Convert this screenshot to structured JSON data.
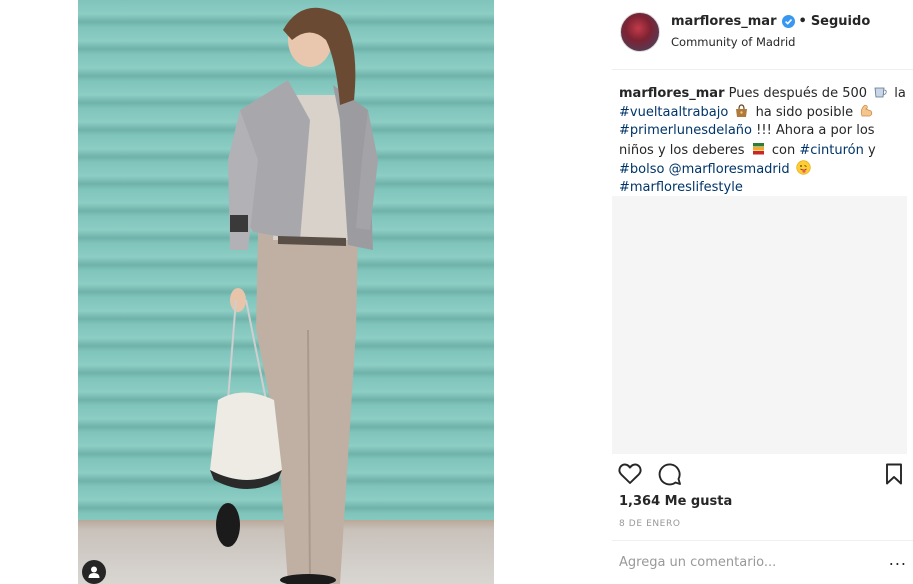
{
  "photo": {
    "alt": ""
  },
  "post": {
    "username": "marflores_mar",
    "follow_status": "Seguido",
    "separator": "•",
    "location": "Community of Madrid",
    "caption": {
      "username": "marflores_mar",
      "t1": "Pues después de 500",
      "t2": "la",
      "h1": "#vueltaaltrabajo",
      "t3": "ha sido posible",
      "h2": "#primerlunesdelaño",
      "t4": "!!! Ahora a por los niños y los deberes",
      "t5": "con",
      "h3": "#cinturón",
      "t6": "y",
      "h4": "#bolso",
      "m1": "@marfloresmadrid",
      "h5": "#marfloreslifestyle"
    },
    "likes": "1,364 Me gusta",
    "date": "8 DE ENERO",
    "comment_placeholder": "Agrega un comentario...",
    "more_label": "..."
  },
  "icons": {
    "verified": "verified-badge-icon",
    "heart": "heart-icon",
    "comment": "comment-bubble-icon",
    "bookmark": "bookmark-icon",
    "user_tag": "user-tag-icon"
  },
  "colors": {
    "hashtag": "#003569",
    "verified": "#3897f0",
    "muted": "#999999",
    "text": "#262626"
  }
}
